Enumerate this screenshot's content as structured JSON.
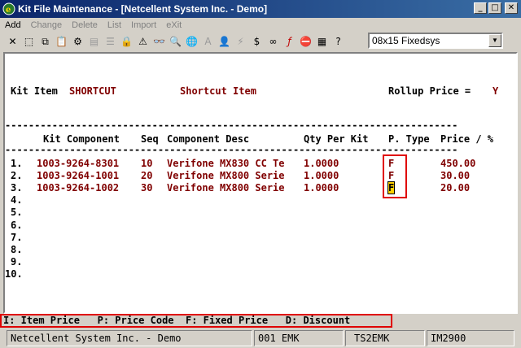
{
  "window": {
    "title": "Kit File Maintenance - [Netcellent System Inc. - Demo]"
  },
  "menu": [
    "Add",
    "Change",
    "Delete",
    "List",
    "Import",
    "eXit"
  ],
  "toolbar": {
    "font_select": "08x15 Fixedsys",
    "icons": [
      "close-icon",
      "select-icon",
      "copy-icon",
      "paste-icon",
      "settings-icon",
      "form-icon",
      "list-icon",
      "lock-icon",
      "warning-icon",
      "binoculars-icon",
      "search-icon",
      "globe-icon",
      "font-icon",
      "person-icon",
      "lightning-icon",
      "dollar-icon",
      "link-icon",
      "function-icon",
      "stop-icon",
      "notes-icon",
      "help-icon"
    ]
  },
  "header": {
    "kit_item_label": "Kit Item",
    "kit_item_value": "SHORTCUT",
    "kit_item_desc": "Shortcut Item",
    "rollup_label": "Rollup Price =",
    "rollup_value": "Y"
  },
  "table": {
    "columns": [
      "Kit Component",
      "Seq",
      "Component Desc",
      "Qty Per Kit",
      "P. Type",
      "Price / %"
    ],
    "rows": [
      {
        "num": "1.",
        "component": "1003-9264-8301",
        "seq": "10",
        "desc": "Verifone MX830 CC Te",
        "qty": "1.0000",
        "ptype": "F",
        "price": "450.00"
      },
      {
        "num": "2.",
        "component": "1003-9264-1001",
        "seq": "20",
        "desc": "Verifone MX800 Serie",
        "qty": "1.0000",
        "ptype": "F",
        "price": "30.00"
      },
      {
        "num": "3.",
        "component": "1003-9264-1002",
        "seq": "30",
        "desc": "Verifone MX800 Serie",
        "qty": "1.0000",
        "ptype": "F",
        "price": "20.00"
      },
      {
        "num": "4."
      },
      {
        "num": "5."
      },
      {
        "num": "6."
      },
      {
        "num": "7."
      },
      {
        "num": "8."
      },
      {
        "num": "9."
      },
      {
        "num": "10."
      }
    ]
  },
  "legend": "I: Item Price   P: Price Code  F: Fixed Price   D: Discount",
  "status": {
    "company": "Netcellent System Inc. - Demo",
    "code": "001 EMK",
    "station": "TS2EMK",
    "program": "IM2900"
  }
}
